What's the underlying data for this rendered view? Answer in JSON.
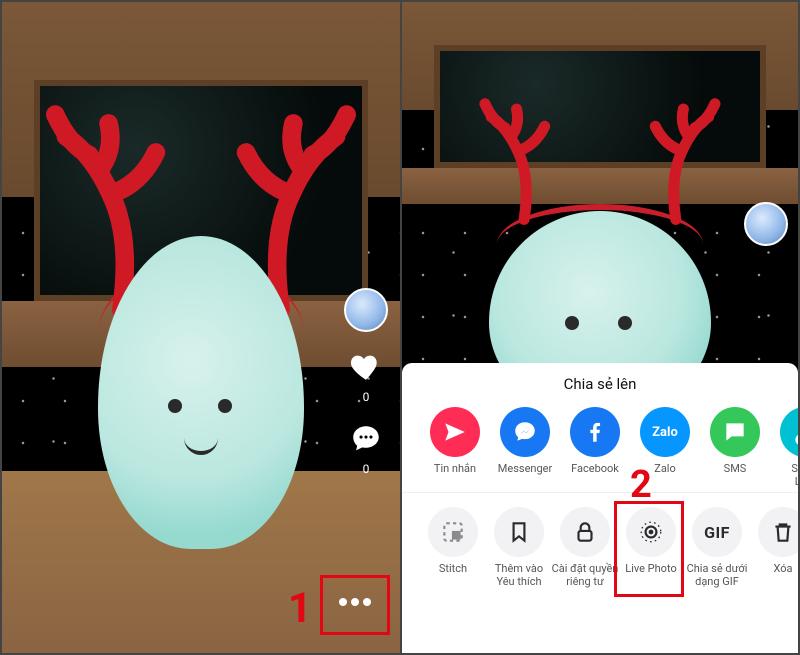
{
  "left": {
    "like_count": "0",
    "comment_count": "0",
    "callout": "1"
  },
  "right": {
    "callout": "2",
    "sheet_title": "Chia sẻ lên",
    "share": [
      {
        "key": "send",
        "label": "Tin nhắn",
        "color": "#ff2d55",
        "icon": "send"
      },
      {
        "key": "messenger",
        "label": "Messenger",
        "color": "#1877f2",
        "icon": "messenger"
      },
      {
        "key": "facebook",
        "label": "Facebook",
        "color": "#1877f2",
        "icon": "facebook"
      },
      {
        "key": "zalo",
        "label": "Zalo",
        "color": "#0596ff",
        "icon": "zalo"
      },
      {
        "key": "sms",
        "label": "SMS",
        "color": "#34c759",
        "icon": "sms"
      },
      {
        "key": "copylink",
        "label": "Sao c\nLiên",
        "color": "#00c1d4",
        "icon": "link"
      }
    ],
    "actions": [
      {
        "key": "stitch",
        "label": "Stitch",
        "icon": "stitch"
      },
      {
        "key": "favorite",
        "label": "Thêm vào\nYêu thích",
        "icon": "bookmark"
      },
      {
        "key": "privacy",
        "label": "Cài đặt quyền\nriêng tư",
        "icon": "lock"
      },
      {
        "key": "livephoto",
        "label": "Live Photo",
        "icon": "livephoto"
      },
      {
        "key": "gif",
        "label": "Chia sẻ dưới\ndạng GIF",
        "icon": "gif"
      },
      {
        "key": "delete",
        "label": "Xóa",
        "icon": "trash"
      }
    ]
  }
}
